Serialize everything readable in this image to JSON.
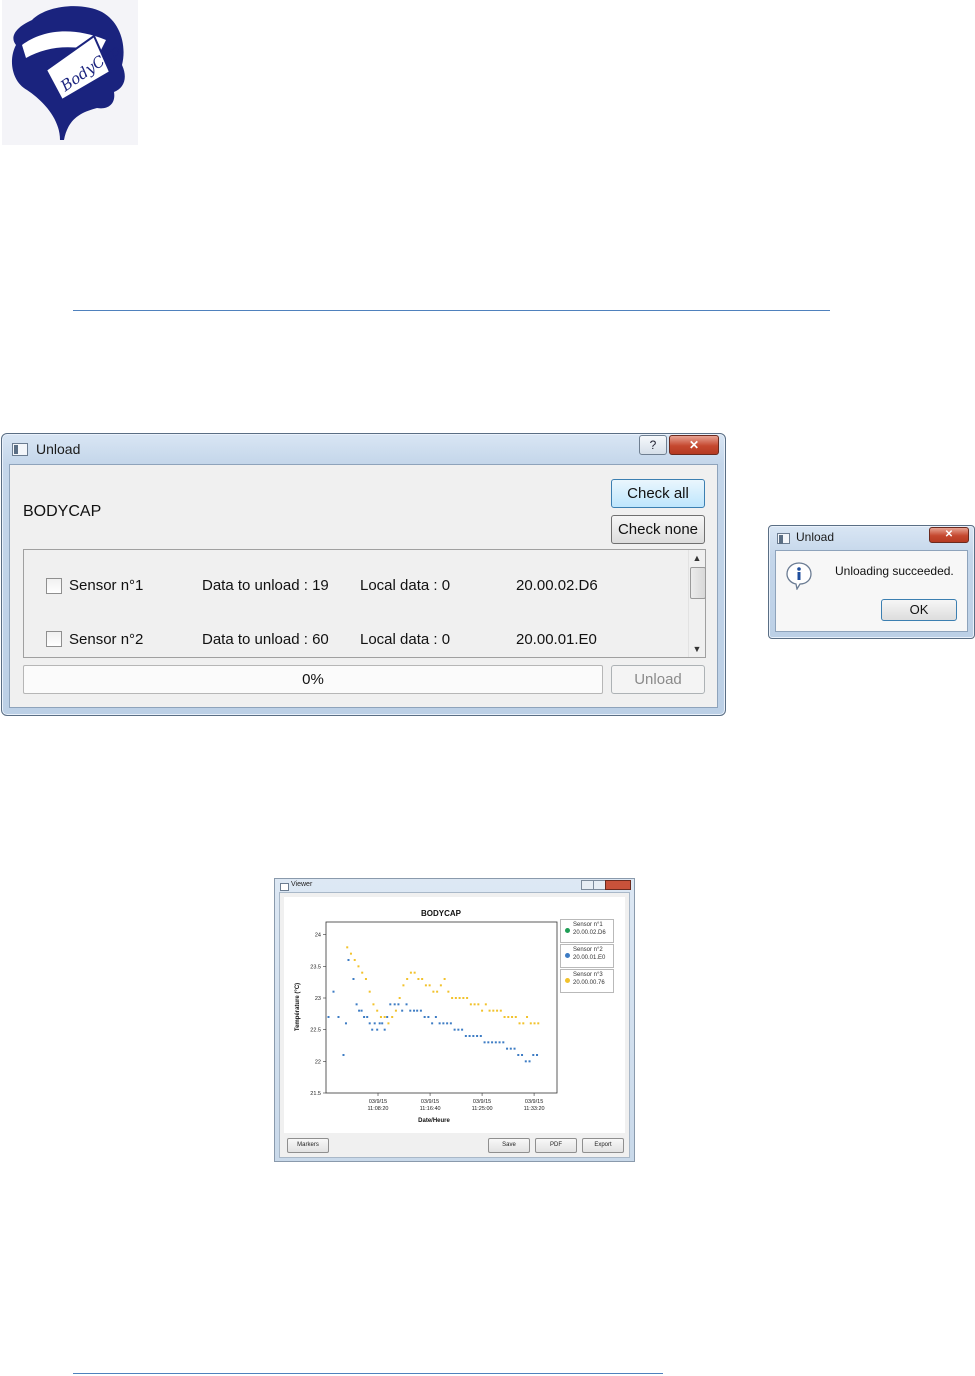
{
  "logo": {
    "text": "BodyCap"
  },
  "unload_dialog": {
    "title": "Unload",
    "help_label": "?",
    "close_label": "✕",
    "device_label": "BODYCAP",
    "check_all": "Check all",
    "check_none": "Check none",
    "sensors": [
      {
        "name": "Sensor n°1",
        "data_to_unload": "Data to unload : 19",
        "local_data": "Local data : 0",
        "id": "20.00.02.D6",
        "checked": false
      },
      {
        "name": "Sensor n°2",
        "data_to_unload": "Data to unload : 60",
        "local_data": "Local data : 0",
        "id": "20.00.01.E0",
        "checked": false
      }
    ],
    "progress": {
      "text": "0%",
      "value": 0
    },
    "unload_button": "Unload"
  },
  "message_box": {
    "title": "Unload",
    "message": "Unloading succeeded.",
    "ok_label": "OK",
    "icon": "info-icon"
  },
  "viewer": {
    "title": "Viewer",
    "buttons": {
      "markers": "Markers",
      "save": "Save",
      "pdf": "PDF",
      "export": "Export"
    },
    "legend": [
      {
        "line1": "Sensor n°1",
        "line2": "20.00.02.D6",
        "color": "#1f9e56"
      },
      {
        "line1": "Sensor n°2",
        "line2": "20.00.01.E0",
        "color": "#3d7cc4"
      },
      {
        "line1": "Sensor n°3",
        "line2": "20.00.00.76",
        "color": "#f2c22b"
      }
    ]
  },
  "chart_data": {
    "type": "scatter",
    "title": "BODYCAP",
    "xlabel": "Date/Heure",
    "ylabel": "Température (°C)",
    "ylim": [
      21.5,
      24.2
    ],
    "yticks": [
      "24",
      "23.5",
      "23",
      "22.5",
      "22",
      "21.5"
    ],
    "ytick_values": [
      24,
      23.5,
      23,
      22.5,
      22,
      21.5
    ],
    "xticks": [
      {
        "line1": "03/9/15",
        "line2": "11:08:20"
      },
      {
        "line1": "03/9/15",
        "line2": "11:16:40"
      },
      {
        "line1": "03/9/15",
        "line2": "11:25:00"
      },
      {
        "line1": "03/9/15",
        "line2": "11:33:20"
      }
    ],
    "xtick_minutes": [
      8.33,
      16.67,
      25.0,
      33.33
    ],
    "xlim": [
      0,
      37
    ],
    "x_unit": "minutes after 11:00:00",
    "series": [
      {
        "name": "Sensor n°2",
        "color": "#3d7cc4",
        "x": [
          0.4,
          1.2,
          2.0,
          2.8,
          3.2,
          3.6,
          4.4,
          4.9,
          5.3,
          5.7,
          6.1,
          6.6,
          7.0,
          7.4,
          7.8,
          8.2,
          8.6,
          9.0,
          9.4,
          9.8,
          10.3,
          11.0,
          11.6,
          12.2,
          12.9,
          13.5,
          14.1,
          14.6,
          15.2,
          15.8,
          16.4,
          17.0,
          17.6,
          18.2,
          18.8,
          19.4,
          20.0,
          20.6,
          21.2,
          21.8,
          22.4,
          23.0,
          23.6,
          24.2,
          24.8,
          25.4,
          26.0,
          26.6,
          27.2,
          27.8,
          28.4,
          29.0,
          29.6,
          30.2,
          30.8,
          31.4,
          32.0,
          32.6,
          33.2,
          33.8
        ],
        "y": [
          22.7,
          23.1,
          22.7,
          22.1,
          22.6,
          23.6,
          23.3,
          22.9,
          22.8,
          22.8,
          22.7,
          22.7,
          22.6,
          22.5,
          22.6,
          22.5,
          22.6,
          22.6,
          22.5,
          22.7,
          22.9,
          22.9,
          22.9,
          22.8,
          22.9,
          22.8,
          22.8,
          22.8,
          22.8,
          22.7,
          22.7,
          22.6,
          22.7,
          22.6,
          22.6,
          22.6,
          22.6,
          22.5,
          22.5,
          22.5,
          22.4,
          22.4,
          22.4,
          22.4,
          22.4,
          22.3,
          22.3,
          22.3,
          22.3,
          22.3,
          22.3,
          22.2,
          22.2,
          22.2,
          22.1,
          22.1,
          22.0,
          22.0,
          22.1,
          22.1
        ]
      },
      {
        "name": "Sensor n°3",
        "color": "#f2c22b",
        "x": [
          3.4,
          4.0,
          4.6,
          5.2,
          5.8,
          6.4,
          7.0,
          7.6,
          8.2,
          8.8,
          9.4,
          10.0,
          10.6,
          11.2,
          11.8,
          12.4,
          13.0,
          13.6,
          14.2,
          14.8,
          15.4,
          16.0,
          16.6,
          17.2,
          17.8,
          18.4,
          19.0,
          19.6,
          20.2,
          20.8,
          21.4,
          22.0,
          22.6,
          23.2,
          23.8,
          24.4,
          25.0,
          25.6,
          26.2,
          26.8,
          27.4,
          28.0,
          28.6,
          29.2,
          29.8,
          30.4,
          31.0,
          31.6,
          32.2,
          32.8,
          33.4,
          34.0
        ],
        "y": [
          23.8,
          23.7,
          23.6,
          23.5,
          23.4,
          23.3,
          23.1,
          22.9,
          22.8,
          22.7,
          22.7,
          22.6,
          22.7,
          22.8,
          23.0,
          23.2,
          23.3,
          23.4,
          23.4,
          23.3,
          23.3,
          23.2,
          23.2,
          23.1,
          23.1,
          23.2,
          23.3,
          23.1,
          23.0,
          23.0,
          23.0,
          23.0,
          23.0,
          22.9,
          22.9,
          22.9,
          22.8,
          22.9,
          22.8,
          22.8,
          22.8,
          22.8,
          22.7,
          22.7,
          22.7,
          22.7,
          22.6,
          22.6,
          22.7,
          22.6,
          22.6,
          22.6
        ]
      }
    ]
  }
}
